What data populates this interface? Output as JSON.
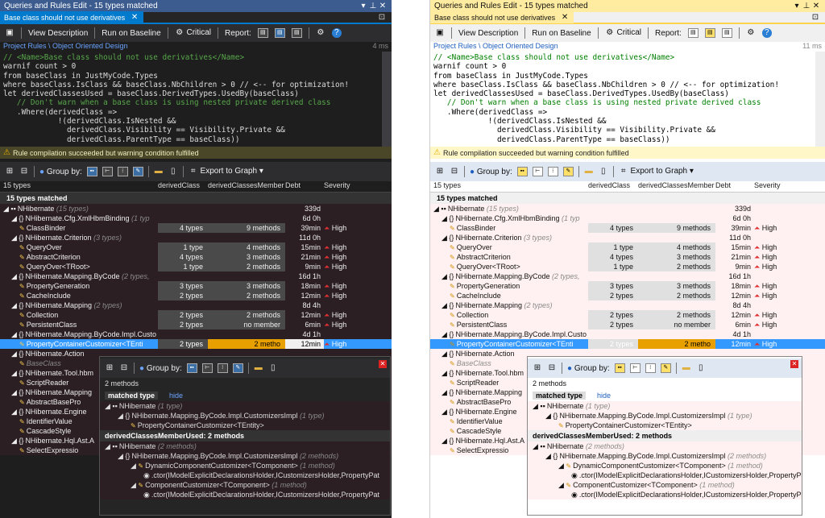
{
  "window_title": "Queries and Rules Edit  - 15 types matched",
  "tab_label": "Base class should not use derivatives",
  "toolbar": {
    "view_description": "View Description",
    "run_on_baseline": "Run on Baseline",
    "critical": "Critical",
    "report": "Report:"
  },
  "crumbs": {
    "path": "Project Rules \\ Object Oriented Design",
    "dark_ms": "4 ms",
    "light_ms": "11 ms"
  },
  "code_lines": [
    "// <Name>Base class should not use derivatives</Name>",
    "warnif count > 0",
    "from baseClass in JustMyCode.Types",
    "where baseClass.IsClass && baseClass.NbChildren > 0 // <-- for optimization!",
    "let derivedClassesUsed = baseClass.DerivedTypes.UsedBy(baseClass)",
    "   // Don't warn when a base class is using nested private derived class",
    "   .Where(derivedClass =>",
    "            !(derivedClass.IsNested &&",
    "              derivedClass.Visibility == Visibility.Private &&",
    "              derivedClass.ParentType == baseClass))"
  ],
  "warning": "Rule compilation succeeded but warning condition fulfilled",
  "grid_toolbar": {
    "group_by": "Group by:",
    "export": "Export to Graph"
  },
  "columns": [
    "15 types",
    "derivedClass",
    "derivedClassesMember",
    "Debt",
    "Severity"
  ],
  "matched_header": "15 types matched",
  "rows": [
    {
      "indent": 0,
      "kind": "asm",
      "name": "NHibernate",
      "note": "(15 types)",
      "dc": "",
      "dm": "",
      "debt": "339d",
      "sev": ""
    },
    {
      "indent": 1,
      "kind": "ns",
      "name": "NHibernate.Cfg.XmlHbmBinding",
      "note": "(1 typ",
      "dc": "",
      "dm": "",
      "debt": "6d  0h",
      "sev": ""
    },
    {
      "indent": 2,
      "kind": "type",
      "name": "ClassBinder",
      "note": "",
      "dc": "4 types",
      "dm": "9 methods",
      "debt": "39min",
      "sev": "High"
    },
    {
      "indent": 1,
      "kind": "ns",
      "name": "NHibernate.Criterion",
      "note": "(3 types)",
      "dc": "",
      "dm": "",
      "debt": "11d  0h",
      "sev": ""
    },
    {
      "indent": 2,
      "kind": "type",
      "name": "QueryOver",
      "note": "",
      "dc": "1 type",
      "dm": "4 methods",
      "debt": "15min",
      "sev": "High"
    },
    {
      "indent": 2,
      "kind": "type",
      "name": "AbstractCriterion",
      "note": "",
      "dc": "4 types",
      "dm": "3 methods",
      "debt": "21min",
      "sev": "High"
    },
    {
      "indent": 2,
      "kind": "type",
      "name": "QueryOver<TRoot>",
      "note": "",
      "dc": "1 type",
      "dm": "2 methods",
      "debt": "9min",
      "sev": "High"
    },
    {
      "indent": 1,
      "kind": "ns",
      "name": "NHibernate.Mapping.ByCode",
      "note": "(2 types,",
      "dc": "",
      "dm": "",
      "debt": "16d  1h",
      "sev": ""
    },
    {
      "indent": 2,
      "kind": "type",
      "name": "PropertyGeneration",
      "note": "",
      "dc": "3 types",
      "dm": "3 methods",
      "debt": "18min",
      "sev": "High"
    },
    {
      "indent": 2,
      "kind": "type",
      "name": "CacheInclude",
      "note": "",
      "dc": "2 types",
      "dm": "2 methods",
      "debt": "12min",
      "sev": "High"
    },
    {
      "indent": 1,
      "kind": "ns",
      "name": "NHibernate.Mapping",
      "note": "(2 types)",
      "dc": "",
      "dm": "",
      "debt": "8d  4h",
      "sev": ""
    },
    {
      "indent": 2,
      "kind": "type",
      "name": "Collection",
      "note": "",
      "dc": "2 types",
      "dm": "2 methods",
      "debt": "12min",
      "sev": "High"
    },
    {
      "indent": 2,
      "kind": "type",
      "name": "PersistentClass",
      "note": "",
      "dc": "2 types",
      "dm": "no member",
      "debt": "6min",
      "sev": "High"
    },
    {
      "indent": 1,
      "kind": "ns",
      "name": "NHibernate.Mapping.ByCode.Impl.Custo",
      "note": "",
      "dc": "",
      "dm": "",
      "debt": "4d  1h",
      "sev": ""
    },
    {
      "indent": 2,
      "kind": "type",
      "name": "PropertyContainerCustomizer<TEnti",
      "note": "",
      "dc": "2 types",
      "dm": "2 metho",
      "debt": "12min",
      "sev": "High",
      "selected": true
    },
    {
      "indent": 1,
      "kind": "ns",
      "name": "NHibernate.Action",
      "note": "",
      "dc": "",
      "dm": "",
      "debt": "",
      "sev": ""
    },
    {
      "indent": 2,
      "kind": "type",
      "name": "BaseClass",
      "note": "",
      "dc": "",
      "dm": "",
      "debt": "",
      "sev": "",
      "faint": true
    },
    {
      "indent": 1,
      "kind": "ns",
      "name": "NHibernate.Tool.hbm",
      "note": "",
      "dc": "",
      "dm": "",
      "debt": "",
      "sev": ""
    },
    {
      "indent": 2,
      "kind": "type",
      "name": "ScriptReader",
      "note": "",
      "dc": "",
      "dm": "",
      "debt": "",
      "sev": ""
    },
    {
      "indent": 1,
      "kind": "ns",
      "name": "NHibernate.Mapping",
      "note": "",
      "dc": "",
      "dm": "",
      "debt": "",
      "sev": ""
    },
    {
      "indent": 2,
      "kind": "type",
      "name": "AbstractBasePro",
      "note": "",
      "dc": "",
      "dm": "",
      "debt": "",
      "sev": ""
    },
    {
      "indent": 1,
      "kind": "ns",
      "name": "NHibernate.Engine",
      "note": "",
      "dc": "",
      "dm": "",
      "debt": "",
      "sev": ""
    },
    {
      "indent": 2,
      "kind": "type",
      "name": "IdentifierValue",
      "note": "",
      "dc": "",
      "dm": "",
      "debt": "",
      "sev": ""
    },
    {
      "indent": 2,
      "kind": "type",
      "name": "CascadeStyle",
      "note": "",
      "dc": "",
      "dm": "",
      "debt": "",
      "sev": ""
    },
    {
      "indent": 1,
      "kind": "ns",
      "name": "NHibernate.Hql.Ast.A",
      "note": "",
      "dc": "",
      "dm": "",
      "debt": "",
      "sev": ""
    },
    {
      "indent": 2,
      "kind": "type",
      "name": "SelectExpressio",
      "note": "",
      "dc": "",
      "dm": "",
      "debt": "",
      "sev": ""
    }
  ],
  "popup": {
    "count": "2 methods",
    "matched_label": "matched type",
    "hide_label": "hide",
    "section2": "derivedClassesMemberUsed: 2 methods",
    "sec1_rows": [
      {
        "indent": 0,
        "kind": "asm",
        "name": "NHibernate",
        "note": "(1 type)"
      },
      {
        "indent": 1,
        "kind": "ns",
        "name": "NHibernate.Mapping.ByCode.Impl.CustomizersImpl",
        "note": "(1 type)"
      },
      {
        "indent": 2,
        "kind": "type",
        "name": "PropertyContainerCustomizer<TEntity>",
        "note": ""
      }
    ],
    "sec2_rows": [
      {
        "indent": 0,
        "kind": "asm",
        "name": "NHibernate",
        "note": "(2 methods)"
      },
      {
        "indent": 1,
        "kind": "ns",
        "name": "NHibernate.Mapping.ByCode.Impl.CustomizersImpl",
        "note": "(2 methods)"
      },
      {
        "indent": 2,
        "kind": "type",
        "name": "DynamicComponentCustomizer<TComponent>",
        "note": "(1 method)"
      },
      {
        "indent": 3,
        "kind": "method",
        "name": ".ctor(IModelExplicitDeclarationsHolder,ICustomizersHolder,PropertyPat",
        "note": ""
      },
      {
        "indent": 2,
        "kind": "type",
        "name": "ComponentCustomizer<TComponent>",
        "note": "(1 method)"
      },
      {
        "indent": 3,
        "kind": "method",
        "name": ".ctor(IModelExplicitDeclarationsHolder,ICustomizersHolder,PropertyPat",
        "note": ""
      }
    ]
  },
  "icons": {
    "save": "save-icon",
    "critical": "critical-icon",
    "settings": "gear-icon",
    "help": "help-icon",
    "close": "close-icon",
    "pin": "pin-icon"
  },
  "colors": {
    "dark_accent": "#007acc",
    "light_accent": "#ffd34a",
    "high": "#e03030",
    "debt_hi": "#e8a000"
  }
}
